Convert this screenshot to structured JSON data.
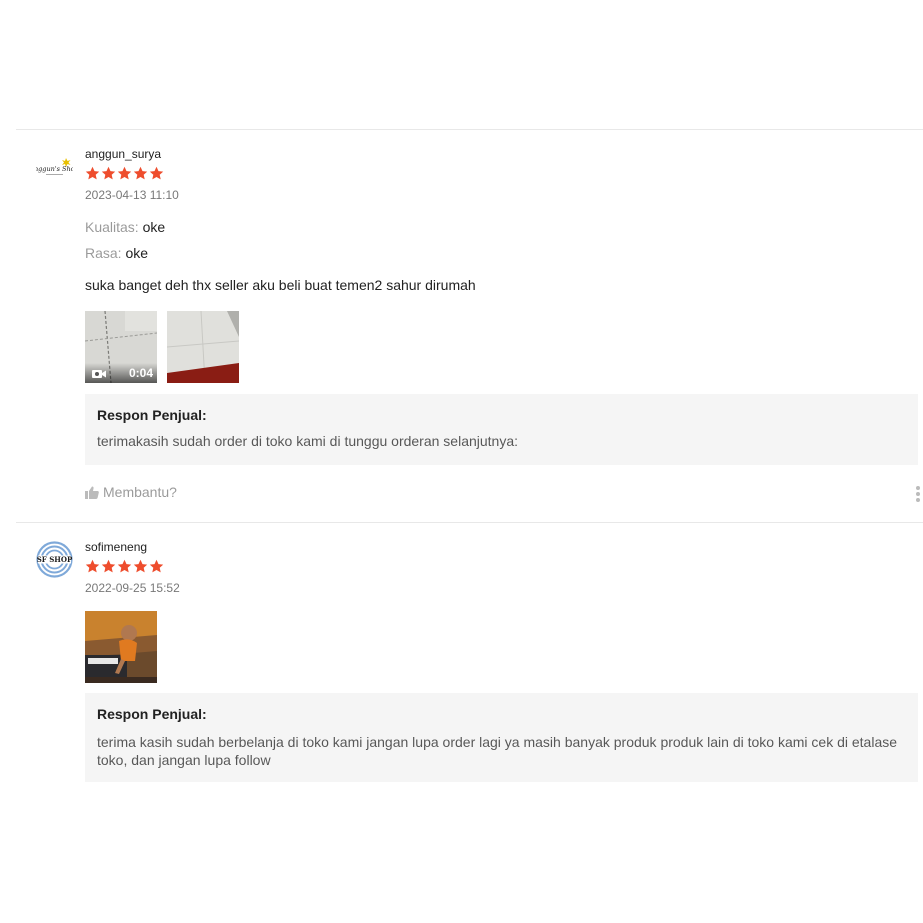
{
  "colors": {
    "star": "#ee4d2d",
    "reply_bg": "#f5f5f5",
    "divider": "#e8e8e8"
  },
  "reviews": [
    {
      "avatar_icon": "shop-logo-icon",
      "avatar_text": "Anggun's Shop",
      "username": "anggun_surya",
      "rating": 5,
      "date": "2023-04-13 11:10",
      "attributes": [
        {
          "key": "Kualitas:",
          "value": "oke"
        },
        {
          "key": "Rasa:",
          "value": "oke"
        }
      ],
      "comment": "suka banget deh thx seller  aku beli buat temen2 sahur dirumah",
      "media": [
        {
          "type": "video",
          "duration": "0:04"
        },
        {
          "type": "image"
        }
      ],
      "reply": {
        "title": "Respon Penjual:",
        "text": "terimakasih sudah order di toko kami di tunggu orderan selanjutnya:"
      },
      "helpful_label": "Membantu?"
    },
    {
      "avatar_icon": "shop-logo-icon",
      "avatar_text": "SF SHOP",
      "username": "sofimeneng",
      "rating": 5,
      "date": "2022-09-25 15:52",
      "media": [
        {
          "type": "image"
        }
      ],
      "reply": {
        "title": "Respon Penjual:",
        "text": "terima kasih sudah berbelanja di toko kami jangan lupa order lagi ya masih banyak produk produk lain di toko kami cek di etalase toko, dan jangan lupa follow"
      }
    }
  ]
}
